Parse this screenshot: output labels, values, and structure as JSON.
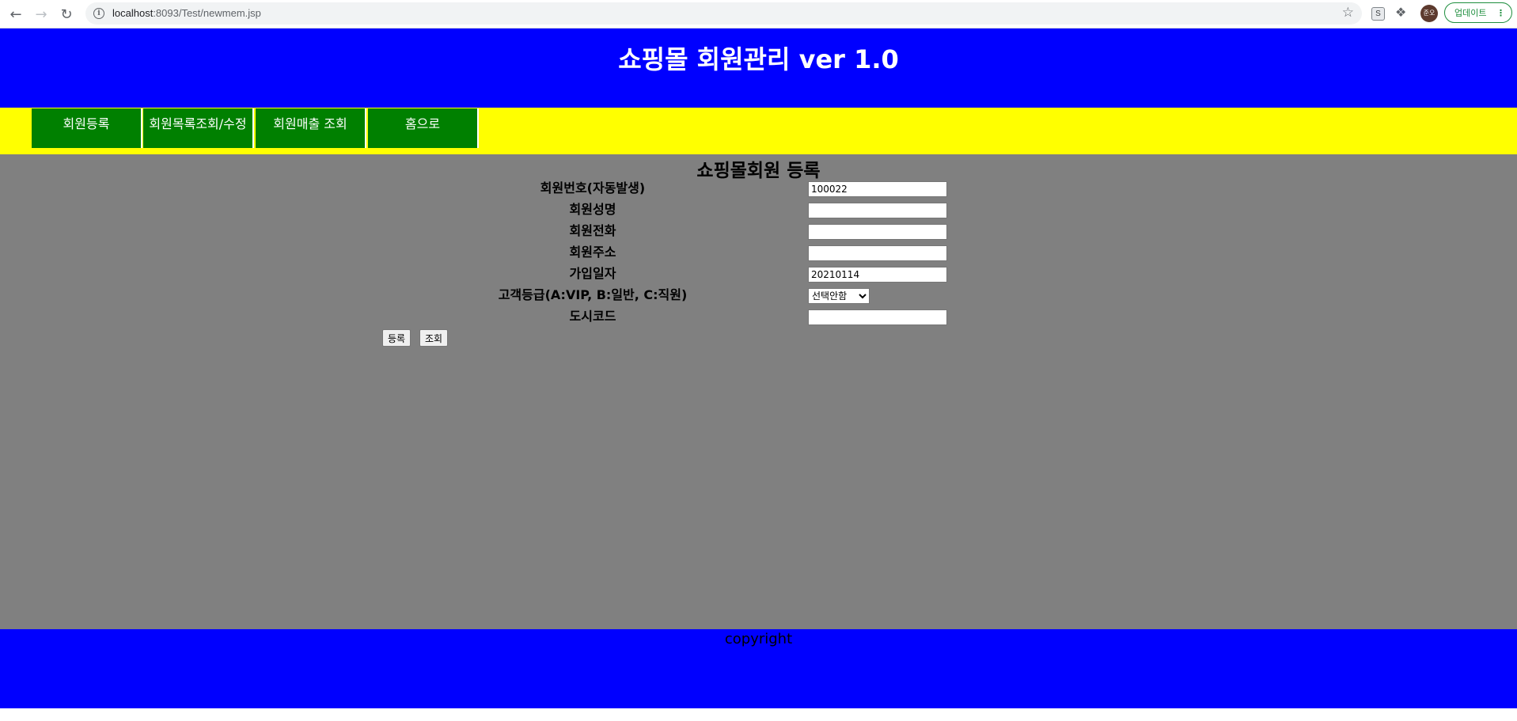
{
  "browser": {
    "url_host": "localhost",
    "url_rest": ":8093/Test/newmem.jsp",
    "profile_initials": "준오",
    "update_label": "업데이트",
    "extension_label": "S"
  },
  "header": {
    "title": "쇼핑몰 회원관리 ver 1.0"
  },
  "menu": {
    "items": [
      {
        "label": "회원등록"
      },
      {
        "label": "회원목록조회/수정"
      },
      {
        "label": "회원매출 조회"
      },
      {
        "label": "홈으로"
      }
    ]
  },
  "form": {
    "title": "쇼핑몰회원 등록",
    "fields": [
      {
        "label": "회원번호(자동발생)",
        "value": "100022"
      },
      {
        "label": "회원성명",
        "value": ""
      },
      {
        "label": "회원전화",
        "value": ""
      },
      {
        "label": "회원주소",
        "value": ""
      },
      {
        "label": "가입일자",
        "value": "20210114"
      },
      {
        "label": "고객등급(A:VIP, B:일반, C:직원)",
        "selected": "선택안함"
      },
      {
        "label": "도시코드",
        "value": ""
      }
    ],
    "buttons": {
      "register": "등록",
      "search": "조회"
    }
  },
  "footer": {
    "text": "copyright"
  },
  "colors": {
    "header_bg": "#0000ff",
    "menu_bg": "#ffff00",
    "menu_item_bg": "#008000",
    "content_bg": "#808080",
    "footer_bg": "#0000ff"
  }
}
